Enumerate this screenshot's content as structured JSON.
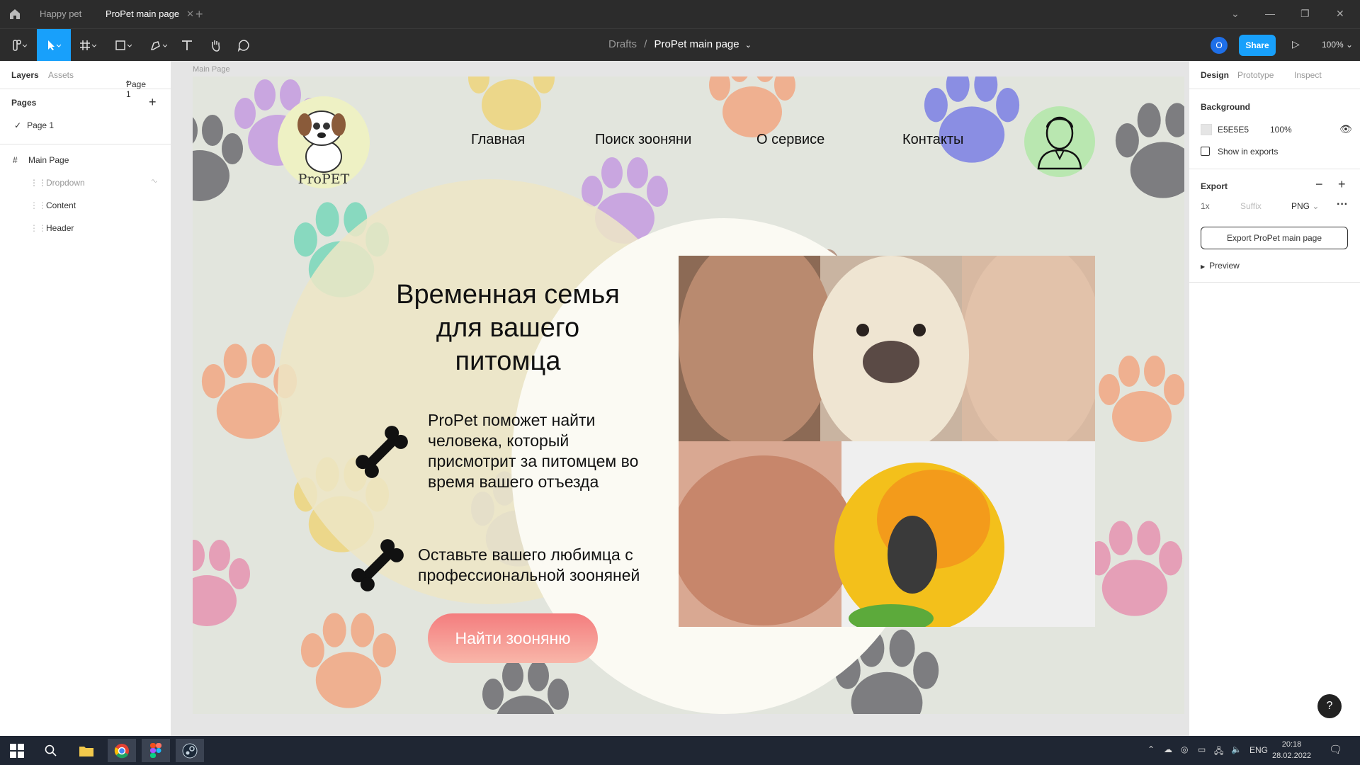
{
  "window": {
    "tabs": [
      {
        "label": "Happy pet"
      },
      {
        "label": "ProPet main page"
      }
    ]
  },
  "toolbar": {
    "breadcrumb_root": "Drafts",
    "breadcrumb_sep": "/",
    "breadcrumb_current": "ProPet main page",
    "avatar_initial": "O",
    "share_label": "Share",
    "zoom": "100%"
  },
  "left_panel": {
    "tab_layers": "Layers",
    "tab_assets": "Assets",
    "page_selector": "Page 1",
    "pages_heading": "Pages",
    "pages": [
      {
        "label": "Page 1"
      }
    ],
    "layers": [
      {
        "label": "Main Page"
      },
      {
        "label": "Dropdown"
      },
      {
        "label": "Content"
      },
      {
        "label": "Header"
      }
    ]
  },
  "canvas": {
    "frame_label": "Main Page",
    "design": {
      "logo_text": "ProPET",
      "nav": [
        "Главная",
        "Поиск зооняни",
        "О сервисе",
        "Контакты"
      ],
      "headline": [
        "Временная семья",
        "для вашего",
        "питомца"
      ],
      "para1": [
        "ProPet поможет найти",
        "человека, который",
        "присмотрит за питомцем во",
        "время вашего отъезда"
      ],
      "para2": [
        "Оставьте вашего любимца с",
        "профессиональной зооняней"
      ],
      "cta": "Найти зооняню"
    }
  },
  "right_panel": {
    "tab_design": "Design",
    "tab_prototype": "Prototype",
    "tab_inspect": "Inspect",
    "background_heading": "Background",
    "background_hex": "E5E5E5",
    "background_opacity": "100%",
    "show_in_exports": "Show in exports",
    "export_heading": "Export",
    "export_scale": "1x",
    "export_suffix_placeholder": "Suffix",
    "export_format": "PNG",
    "export_button": "Export ProPet main page",
    "preview": "Preview",
    "help": "?"
  },
  "taskbar": {
    "lang": "ENG",
    "time": "20:18",
    "date": "28.02.2022"
  },
  "colors": {
    "accent": "#18a0fb",
    "cta_top": "#f47d7e",
    "frame_bg": "#e2e5dd"
  }
}
